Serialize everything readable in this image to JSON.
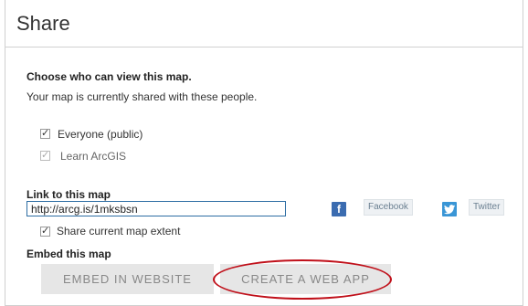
{
  "dialog": {
    "title": "Share"
  },
  "view_section": {
    "heading": "Choose who can view this map.",
    "description": "Your map is currently shared with these people.",
    "options": [
      {
        "label": "Everyone (public)",
        "checked": true,
        "disabled": false
      },
      {
        "label": "Learn ArcGIS",
        "checked": true,
        "disabled": true
      }
    ]
  },
  "link_section": {
    "heading": "Link to this map",
    "link_value": "http://arcg.is/1mksbsn",
    "facebook_icon": "facebook-icon",
    "facebook_icon_glyph": "f",
    "facebook_label": "Facebook",
    "twitter_icon": "twitter-icon",
    "twitter_label": "Twitter",
    "share_extent_label": "Share current map extent",
    "share_extent_checked": true
  },
  "embed_section": {
    "heading": "Embed this map",
    "embed_website_label": "EMBED IN WEBSITE",
    "create_web_app_label": "CREATE A WEB APP"
  },
  "colors": {
    "highlight": "#c0101a",
    "input_border": "#2d6da3",
    "facebook": "#3b6cb0",
    "twitter": "#3a96d6"
  }
}
